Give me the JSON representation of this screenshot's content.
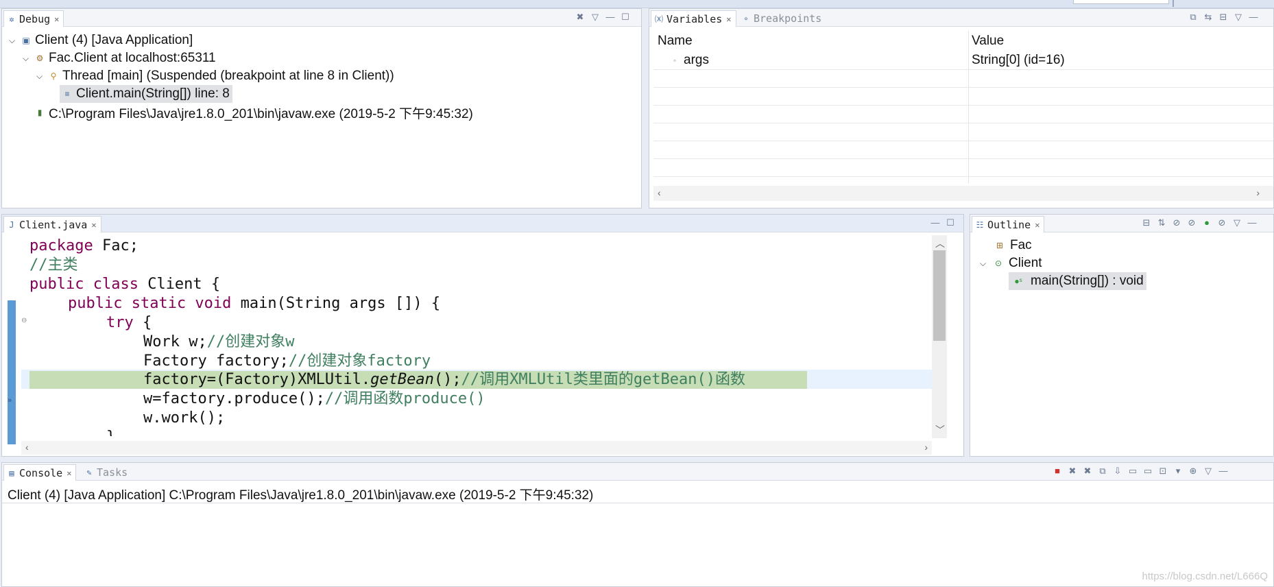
{
  "debug": {
    "tab_label": "Debug",
    "tree": [
      {
        "label": "Client (4) [Java Application]"
      },
      {
        "label": "Fac.Client at localhost:65311"
      },
      {
        "label": "Thread [main] (Suspended (breakpoint at line 8 in Client))"
      },
      {
        "label": "Client.main(String[]) line: 8"
      },
      {
        "label": "C:\\Program Files\\Java\\jre1.8.0_201\\bin\\javaw.exe (2019-5-2 下午9:45:32)"
      }
    ]
  },
  "variables": {
    "tab_label": "Variables",
    "breakpoints_tab_label": "Breakpoints",
    "columns": [
      "Name",
      "Value"
    ],
    "rows": [
      {
        "name": "args",
        "value": "String[0]  (id=16)"
      }
    ]
  },
  "editor": {
    "tab_label": "Client.java",
    "lines": {
      "l1_kw": "package",
      "l1_rest": " Fac;",
      "l2_cm": "//主类",
      "l3_kw": "public class",
      "l3_rest": " Client {",
      "l4_kw": "public static void",
      "l4_rest": " main(String args []) {",
      "l5_kw": "try",
      "l5_rest": " {",
      "l6_code": "Work w;",
      "l6_cm": "//创建对象w",
      "l7_code": "Factory factory;",
      "l7_cm": "//创建对象factory",
      "l8_code": "factory=(Factory)XMLUtil.",
      "l8_it": "getBean",
      "l8_code2": "();",
      "l8_cm": "//调用XMLUtil类里面的getBean()函数",
      "l9_code": "w=factory.produce();",
      "l9_cm": "//调用函数produce()",
      "l10_code": "w.work();",
      "l11_code": "}"
    }
  },
  "outline": {
    "tab_label": "Outline",
    "items": [
      {
        "label": "Fac"
      },
      {
        "label": "Client"
      },
      {
        "label": "main(String[]) : void"
      }
    ]
  },
  "console": {
    "tab_label": "Console",
    "tasks_tab_label": "Tasks",
    "text": "Client (4) [Java Application] C:\\Program Files\\Java\\jre1.8.0_201\\bin\\javaw.exe (2019-5-2 下午9:45:32)"
  },
  "watermark": "https://blog.csdn.net/L666Q",
  "colors": {
    "keyword": "#7f0055",
    "comment": "#3f7f5f",
    "highlight": "#c7ddb6",
    "selection": "#dfe1e5",
    "marker": "#5b9bd5"
  }
}
